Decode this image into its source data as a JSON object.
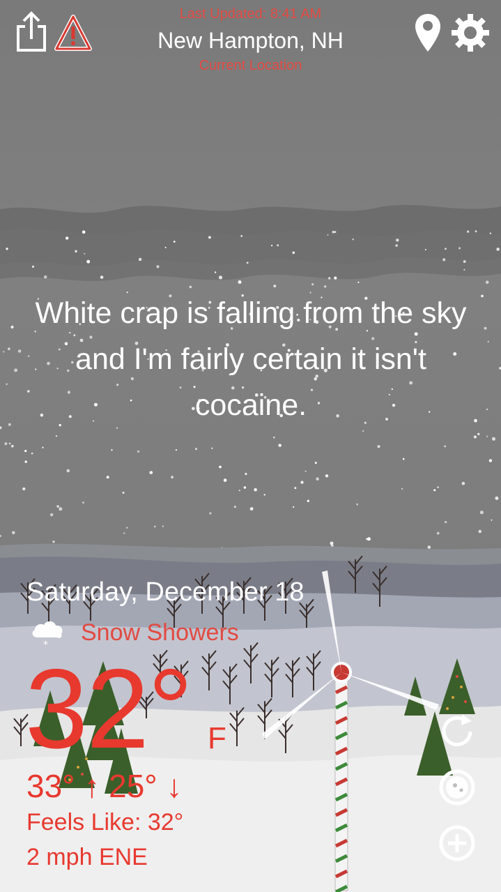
{
  "header": {
    "last_updated": "Last Updated: 8:41 AM",
    "city": "New Hampton, NH",
    "current_location": "Current Location",
    "share_icon": "share-icon",
    "alert_icon": "warning-icon",
    "location_icon": "location-pin-icon",
    "settings_icon": "gear-icon"
  },
  "message": "White crap is falling from the sky and I'm fairly certain it isn't cocaine.",
  "weather": {
    "date": "Saturday, December 18",
    "condition": "Snow Showers",
    "condition_icon": "snow-cloud-icon",
    "temperature": "32°",
    "unit": "F",
    "high_low": "33° ↑ 25° ↓",
    "feels_like": "Feels Like: 32°",
    "wind": "2 mph ENE"
  },
  "actions": {
    "refresh_icon": "refresh-icon",
    "radar_icon": "radar-icon",
    "add_icon": "add-icon"
  },
  "colors": {
    "sky": "#7c7c7c",
    "accent_red": "#e8392f",
    "text_white": "#ffffff",
    "snow_ground": "#ebebeb"
  }
}
